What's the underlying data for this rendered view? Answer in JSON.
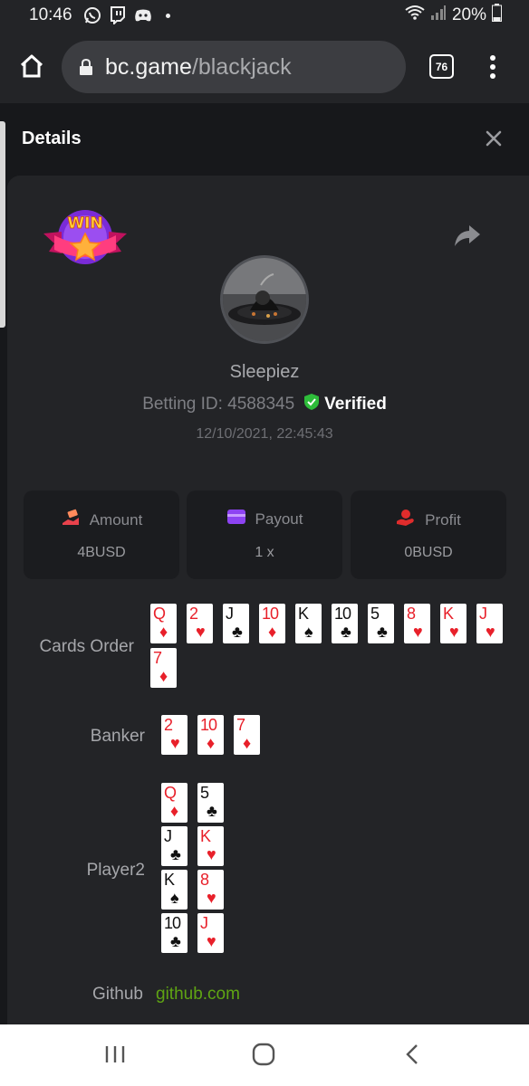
{
  "status_bar": {
    "time": "10:46",
    "battery": "20%"
  },
  "browser": {
    "url_host": "bc.game",
    "url_path": "/blackjack",
    "tab_count": "76"
  },
  "modal": {
    "title": "Details"
  },
  "bet": {
    "username": "Sleepiez",
    "betting_id_label": "Betting ID: 4588345",
    "verified_label": "Verified",
    "datetime": "12/10/2021, 22:45:43",
    "win_badge_text": "WIN"
  },
  "stats": [
    {
      "label": "Amount",
      "value": "4BUSD",
      "color": "#e8424c"
    },
    {
      "label": "Payout",
      "value": "1 x",
      "color": "#8d43f2"
    },
    {
      "label": "Profit",
      "value": "0BUSD",
      "color": "#e02c2c"
    }
  ],
  "labels": {
    "cards_order": "Cards Order",
    "banker": "Banker",
    "player2": "Player2",
    "github": "Github"
  },
  "github_link": "github.com",
  "cards_order": [
    {
      "rank": "Q",
      "suit": "♦",
      "color": "red"
    },
    {
      "rank": "2",
      "suit": "♥",
      "color": "red"
    },
    {
      "rank": "J",
      "suit": "♣",
      "color": "black"
    },
    {
      "rank": "10",
      "suit": "♦",
      "color": "red"
    },
    {
      "rank": "K",
      "suit": "♠",
      "color": "black"
    },
    {
      "rank": "10",
      "suit": "♣",
      "color": "black"
    },
    {
      "rank": "5",
      "suit": "♣",
      "color": "black"
    },
    {
      "rank": "8",
      "suit": "♥",
      "color": "red"
    },
    {
      "rank": "K",
      "suit": "♥",
      "color": "red"
    },
    {
      "rank": "J",
      "suit": "♥",
      "color": "red"
    },
    {
      "rank": "7",
      "suit": "♦",
      "color": "red"
    }
  ],
  "banker": [
    {
      "rank": "2",
      "suit": "♥",
      "color": "red"
    },
    {
      "rank": "10",
      "suit": "♦",
      "color": "red"
    },
    {
      "rank": "7",
      "suit": "♦",
      "color": "red"
    }
  ],
  "player2": [
    [
      {
        "rank": "Q",
        "suit": "♦",
        "color": "red"
      },
      {
        "rank": "5",
        "suit": "♣",
        "color": "black"
      }
    ],
    [
      {
        "rank": "J",
        "suit": "♣",
        "color": "black"
      },
      {
        "rank": "K",
        "suit": "♥",
        "color": "red"
      }
    ],
    [
      {
        "rank": "K",
        "suit": "♠",
        "color": "black"
      },
      {
        "rank": "8",
        "suit": "♥",
        "color": "red"
      }
    ],
    [
      {
        "rank": "10",
        "suit": "♣",
        "color": "black"
      },
      {
        "rank": "J",
        "suit": "♥",
        "color": "red"
      }
    ]
  ],
  "icons": {
    "home": "home-icon",
    "lock": "lock-icon",
    "share": "share-icon",
    "close": "close-icon",
    "verified": "shield-check-icon",
    "amount": "money-hand-icon",
    "payout": "card-icon",
    "profit": "profit-hand-icon"
  },
  "colors": {
    "accent_green": "#5fa413",
    "verified_green": "#2ebd3a",
    "background": "#232427"
  }
}
